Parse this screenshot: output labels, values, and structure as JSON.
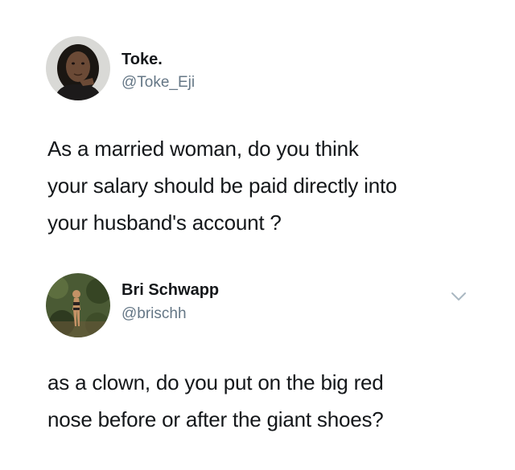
{
  "tweets": [
    {
      "display_name": "Toke.",
      "handle": "@Toke_Eji",
      "text_lines": [
        "As a married woman, do you think",
        "your salary should be paid directly into",
        "your husband's account ?"
      ]
    },
    {
      "display_name": "Bri Schwapp",
      "handle": "@brischh",
      "text_lines": [
        "as a clown, do you put on the big red",
        "nose before or after the giant shoes?"
      ],
      "menu_icon": "chevron-down-icon"
    }
  ],
  "colors": {
    "text": "#14171a",
    "secondary_text": "#657786",
    "chevron": "#aab8c2"
  }
}
